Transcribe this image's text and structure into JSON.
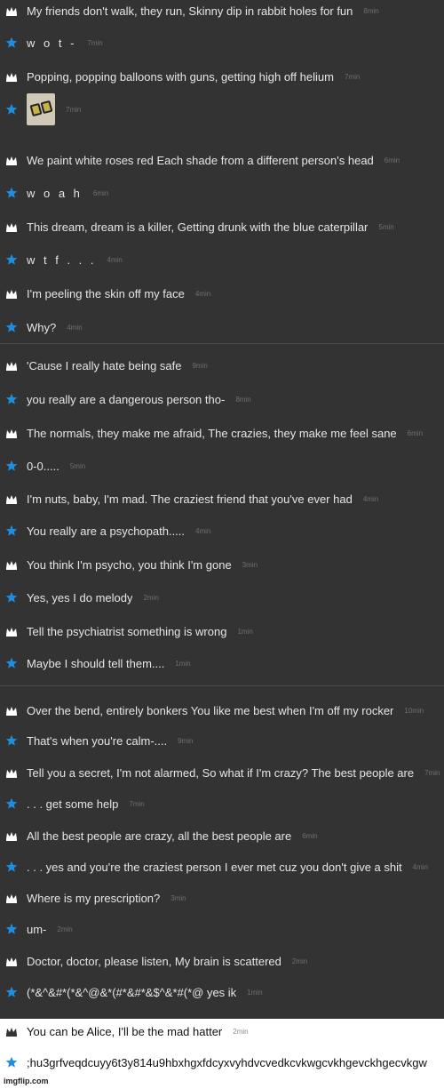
{
  "colors": {
    "star": "#1e8fe0",
    "crown": "#ffffff",
    "background": "#333333"
  },
  "messages": [
    {
      "icon": "crown-icon",
      "text": "My friends don't walk, they run, Skinny dip in rabbit holes for fun",
      "time": "8min"
    },
    {
      "icon": "star-icon",
      "text": "w o t -",
      "time": "7min"
    },
    {
      "icon": "crown-icon",
      "text": "Popping, popping balloons with guns, getting high off helium",
      "time": "7min"
    },
    {
      "icon": "star-icon",
      "text": "",
      "time": "7min"
    },
    {
      "icon": "crown-icon",
      "text": "We paint white roses red Each shade from a different person's head",
      "time": "6min"
    },
    {
      "icon": "star-icon",
      "text": "w o a h",
      "time": "6min"
    },
    {
      "icon": "crown-icon",
      "text": "This dream, dream is a killer, Getting drunk with the blue caterpillar",
      "time": "5min"
    },
    {
      "icon": "star-icon",
      "text": "w t f . . .",
      "time": "4min"
    },
    {
      "icon": "crown-icon",
      "text": "I'm peeling the skin off my face",
      "time": "4min"
    },
    {
      "icon": "star-icon",
      "text": "Why?",
      "time": "4min"
    },
    {
      "icon": "crown-icon",
      "text": "'Cause I really hate being safe",
      "time": "9min"
    },
    {
      "icon": "star-icon",
      "text": "you really are a dangerous person tho-",
      "time": "8min"
    },
    {
      "icon": "crown-icon",
      "text": "The normals, they make me afraid, The crazies, they make me feel sane",
      "time": "6min"
    },
    {
      "icon": "star-icon",
      "text": "0-0.....",
      "time": "5min"
    },
    {
      "icon": "crown-icon",
      "text": "I'm nuts, baby, I'm mad. The craziest friend that you've ever had",
      "time": "4min"
    },
    {
      "icon": "star-icon",
      "text": "You really are a psychopath.....",
      "time": "4min"
    },
    {
      "icon": "crown-icon",
      "text": "You think I'm psycho, you think I'm gone",
      "time": "3min"
    },
    {
      "icon": "star-icon",
      "text": "Yes, yes I do melody",
      "time": "2min"
    },
    {
      "icon": "crown-icon",
      "text": "Tell the psychiatrist something is wrong",
      "time": "1min"
    },
    {
      "icon": "star-icon",
      "text": "Maybe I should tell them....",
      "time": "1min"
    },
    {
      "icon": "crown-icon",
      "text": "Over the bend, entirely bonkers You like me best when I'm off my rocker",
      "time": "10min"
    },
    {
      "icon": "star-icon",
      "text": "That's when you're calm-....",
      "time": "9min"
    },
    {
      "icon": "crown-icon",
      "text": "Tell you a secret, I'm not alarmed, So what if I'm crazy? The best people are",
      "time": "7min"
    },
    {
      "icon": "star-icon",
      "text": ". . . get some help",
      "time": "7min"
    },
    {
      "icon": "crown-icon",
      "text": "All the best people are crazy, all the best people are",
      "time": "6min"
    },
    {
      "icon": "star-icon",
      "text": ". . . yes and you're the craziest person I ever met cuz you don't give a shit",
      "time": "4min"
    },
    {
      "icon": "crown-icon",
      "text": "Where is my prescription?",
      "time": "3min"
    },
    {
      "icon": "star-icon",
      "text": "um-",
      "time": "2min"
    },
    {
      "icon": "crown-icon",
      "text": "Doctor, doctor, please listen, My brain is scattered",
      "time": "2min"
    },
    {
      "icon": "star-icon",
      "text": "(*&^&#*(*&^@&*(#*&#*&$^&*#(*@ yes ik",
      "time": "1min"
    },
    {
      "icon": "crown-icon",
      "text": "You can be Alice, I'll be the mad hatter",
      "time": "2min"
    },
    {
      "icon": "star-icon",
      "text": ";hu3grfveqdcuyy6t3y814u9hbxhgxfdcyxvyhdvcvedkcvkwgcvkhgevckhgecvkgw",
      "time": ""
    }
  ],
  "watermark": "imgflip.com"
}
